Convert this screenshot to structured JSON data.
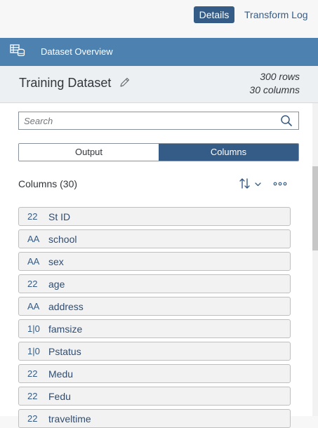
{
  "toolbar": {
    "details_label": "Details",
    "transform_log_label": "Transform Log"
  },
  "panel": {
    "title": "Dataset Overview",
    "icon": "dataset-icon"
  },
  "dataset": {
    "name": "Training Dataset",
    "rows": "300 rows",
    "columns": "30 columns"
  },
  "search": {
    "placeholder": "Search",
    "value": ""
  },
  "tabs": {
    "output_label": "Output",
    "columns_label": "Columns",
    "selected": "Columns"
  },
  "columns_section": {
    "title": "Columns (30)",
    "items": [
      {
        "name": "St ID",
        "type_icon": "22"
      },
      {
        "name": "school",
        "type_icon": "AA"
      },
      {
        "name": "sex",
        "type_icon": "AA"
      },
      {
        "name": "age",
        "type_icon": "22"
      },
      {
        "name": "address",
        "type_icon": "AA"
      },
      {
        "name": "famsize",
        "type_icon": "1|0"
      },
      {
        "name": "Pstatus",
        "type_icon": "1|0"
      },
      {
        "name": "Medu",
        "type_icon": "22"
      },
      {
        "name": "Fedu",
        "type_icon": "22"
      },
      {
        "name": "traveltime",
        "type_icon": "22"
      }
    ]
  },
  "colors": {
    "accent": "#355c87",
    "header_bar": "#4d81b0",
    "subheader_bg": "#edf0f3"
  }
}
